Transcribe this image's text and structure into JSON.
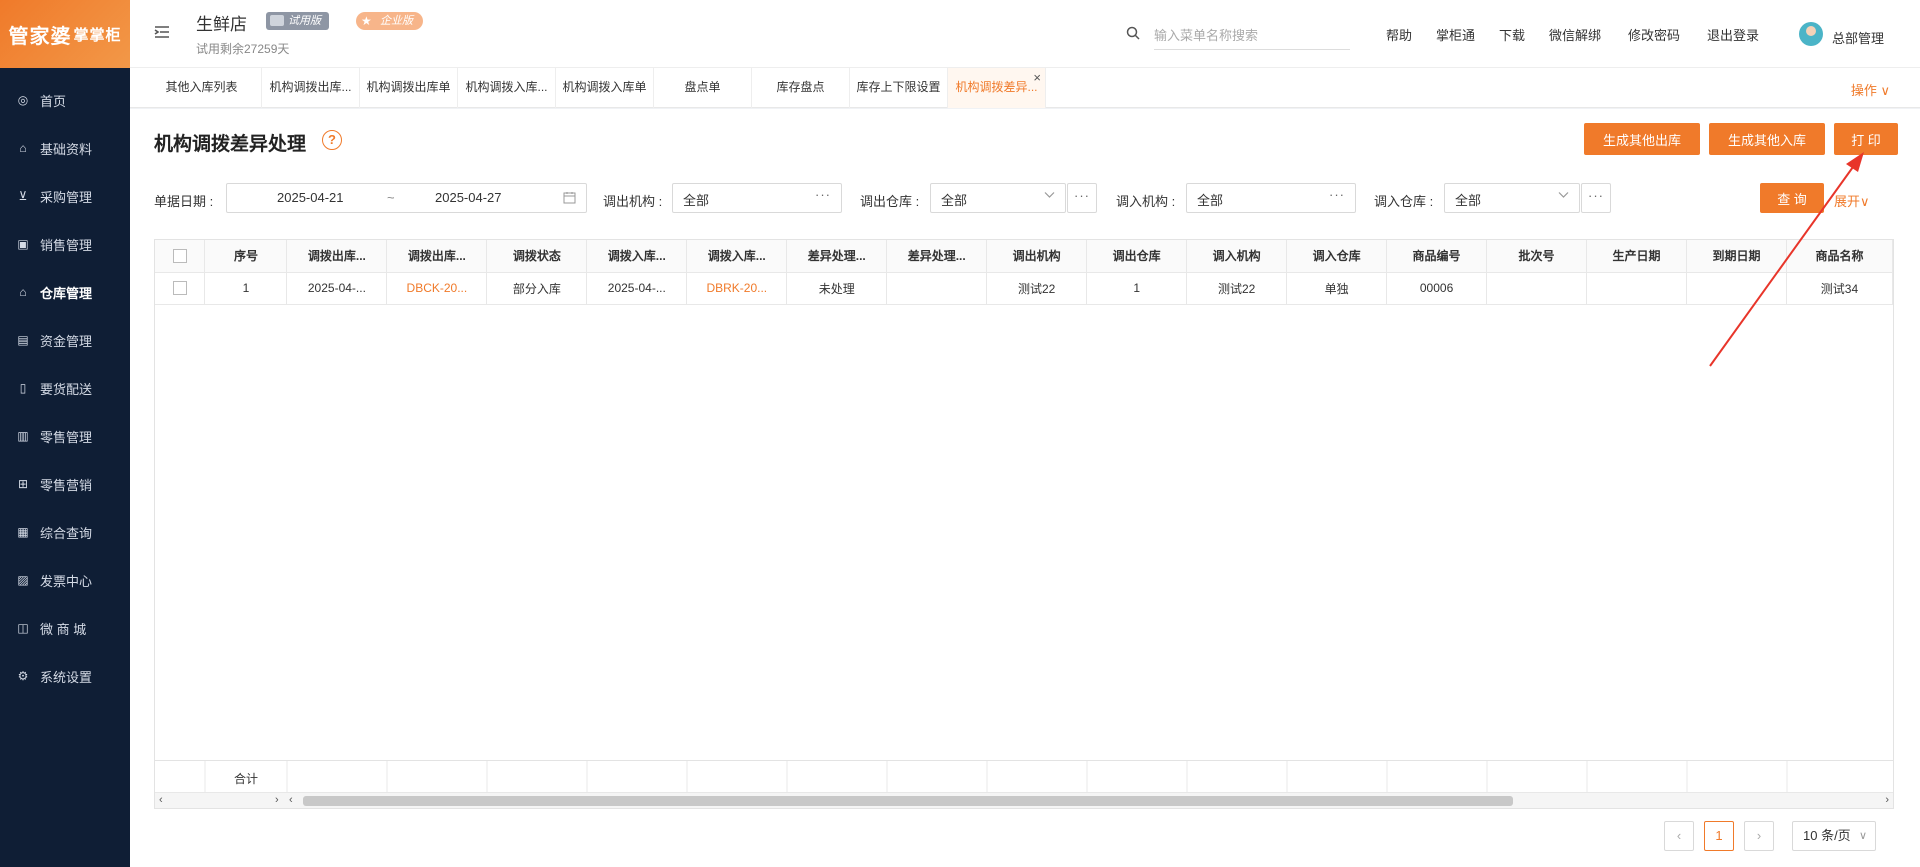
{
  "logo": {
    "main": "管家婆",
    "sub": "掌掌柜"
  },
  "sidebar": {
    "items": [
      {
        "label": "首页",
        "icon": "globe-icon"
      },
      {
        "label": "基础资料",
        "icon": "home-icon"
      },
      {
        "label": "采购管理",
        "icon": "cart-icon"
      },
      {
        "label": "销售管理",
        "icon": "sales-icon"
      },
      {
        "label": "仓库管理",
        "icon": "warehouse-icon",
        "active": true
      },
      {
        "label": "资金管理",
        "icon": "money-icon"
      },
      {
        "label": "要货配送",
        "icon": "delivery-icon"
      },
      {
        "label": "零售管理",
        "icon": "retail-icon"
      },
      {
        "label": "零售营销",
        "icon": "gift-icon"
      },
      {
        "label": "综合查询",
        "icon": "chart-icon"
      },
      {
        "label": "发票中心",
        "icon": "invoice-icon"
      },
      {
        "label": "微 商 城",
        "icon": "shop-icon"
      },
      {
        "label": "系统设置",
        "icon": "settings-icon"
      }
    ]
  },
  "header": {
    "store_name": "生鲜店",
    "trial_badge": "试用版",
    "enterprise_badge": "企业版",
    "trial_left": "试用剩余27259天",
    "search_placeholder": "输入菜单名称搜索",
    "links": [
      "帮助",
      "掌柜通",
      "下载",
      "微信解绑",
      "修改密码",
      "退出登录"
    ],
    "user_name": "总部管理"
  },
  "tabs": [
    {
      "label": "其他入库列表"
    },
    {
      "label": "机构调拨出库..."
    },
    {
      "label": "机构调拨出库单"
    },
    {
      "label": "机构调拨入库..."
    },
    {
      "label": "机构调拨入库单"
    },
    {
      "label": "盘点单"
    },
    {
      "label": "库存盘点"
    },
    {
      "label": "库存上下限设置"
    },
    {
      "label": "机构调拨差异...",
      "active": true
    }
  ],
  "tab_ops": "操作 ∨",
  "page": {
    "title": "机构调拨差异处理",
    "help": "?",
    "buttons": {
      "gen_out": "生成其他出库",
      "gen_in": "生成其他入库",
      "print": "打 印"
    }
  },
  "filters": {
    "date_label": "单据日期 :",
    "date_from": "2025-04-21",
    "date_sep": "~",
    "date_to": "2025-04-27",
    "out_org_label": "调出机构 :",
    "out_org_value": "全部",
    "out_wh_label": "调出仓库 :",
    "out_wh_value": "全部",
    "in_org_label": "调入机构 :",
    "in_org_value": "全部",
    "in_wh_label": "调入仓库 :",
    "in_wh_value": "全部",
    "query": "查 询",
    "expand": "展开∨"
  },
  "table": {
    "headers": [
      "序号",
      "调拨出库...",
      "调拨出库...",
      "调拨状态",
      "调拨入库...",
      "调拨入库...",
      "差异处理...",
      "差异处理...",
      "调出机构",
      "调出仓库",
      "调入机构",
      "调入仓库",
      "商品编号",
      "批次号",
      "生产日期",
      "到期日期",
      "商品名称"
    ],
    "rows": [
      [
        "1",
        "2025-04-...",
        "DBCK-20...",
        "部分入库",
        "2025-04-...",
        "DBRK-20...",
        "未处理",
        "",
        "测试22",
        "1",
        "测试22",
        "单独",
        "00006",
        "",
        "",
        "",
        "测试34"
      ]
    ],
    "link_cols": [
      2,
      5
    ],
    "sum_label": "合计"
  },
  "pagination": {
    "prev": "‹",
    "current": "1",
    "next": "›",
    "page_size": "10 条/页"
  },
  "colors": {
    "accent": "#f07a2a",
    "sidebar": "#0f1e35"
  }
}
